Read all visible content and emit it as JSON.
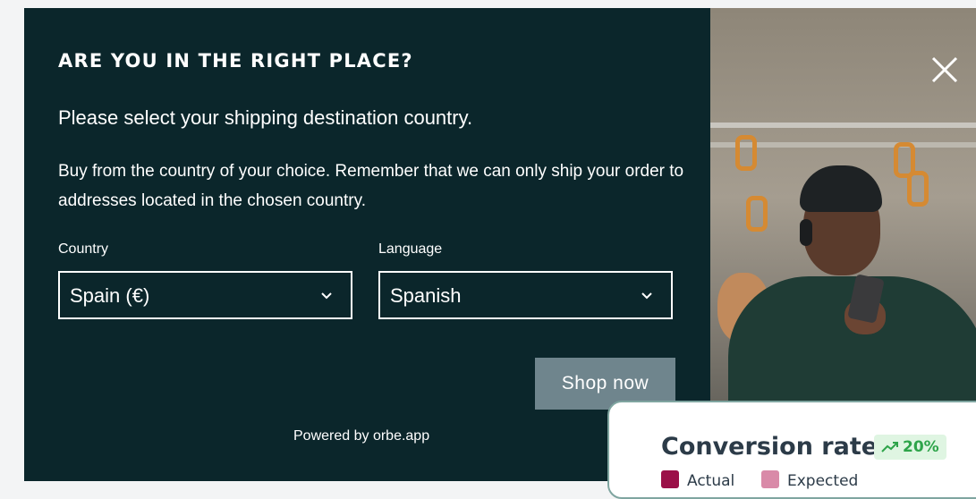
{
  "modal": {
    "title": "ARE YOU IN THE RIGHT PLACE?",
    "subtitle": "Please select your shipping destination country.",
    "description": "Buy from the country of your choice. Remember that we can only ship your order to addresses located in the chosen country.",
    "country": {
      "label": "Country",
      "value": "Spain (€)"
    },
    "language": {
      "label": "Language",
      "value": "Spanish"
    },
    "shop_button": "Shop now",
    "powered_by": "Powered by orbe.app",
    "close_icon": "close-icon"
  },
  "widget": {
    "title": "Conversion rate",
    "badge": "20%",
    "legend": [
      {
        "label": "Actual",
        "color": "#9b1048"
      },
      {
        "label": "Expected",
        "color": "#d98aa8"
      }
    ]
  },
  "colors": {
    "modal_background": "#0b262b",
    "button_background": "#6f858d",
    "page_background": "#f3f4f5"
  }
}
